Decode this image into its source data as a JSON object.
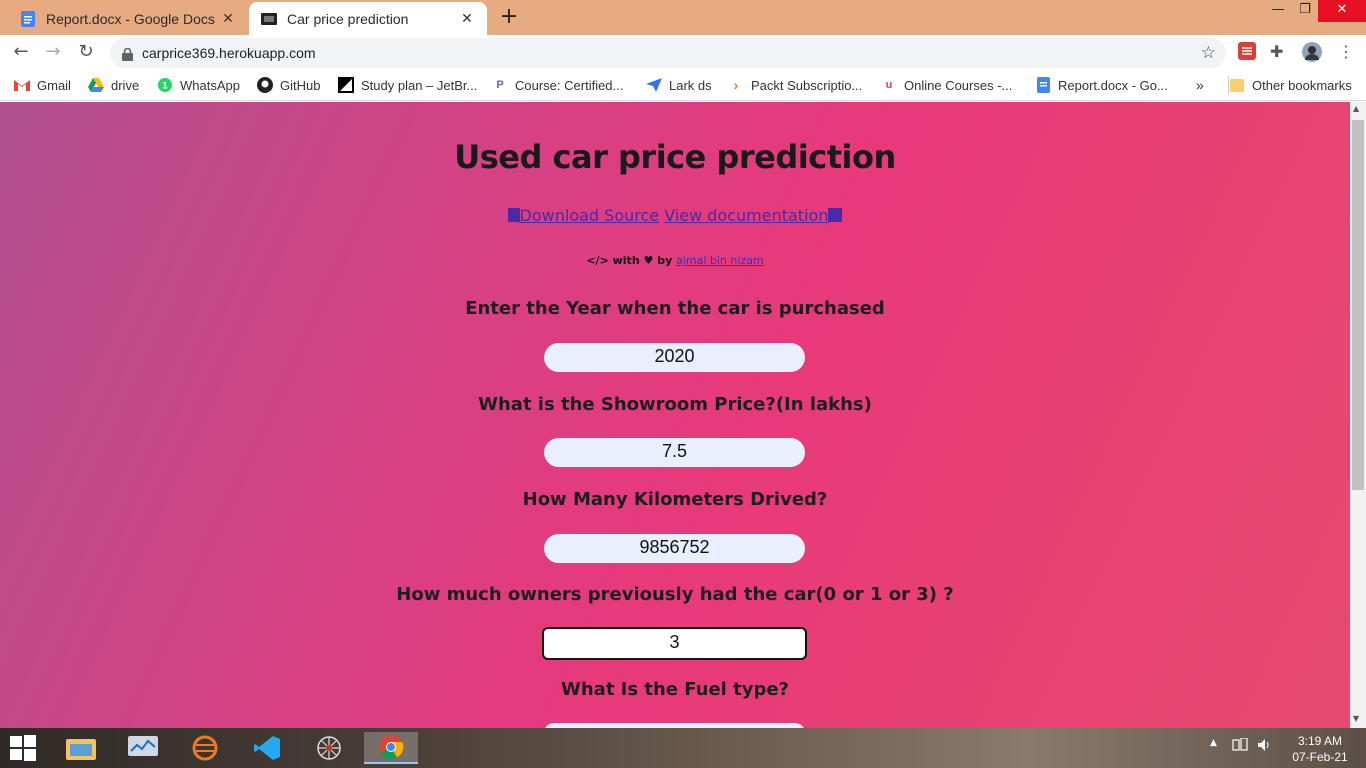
{
  "browser": {
    "tabs": [
      {
        "title": "Report.docx - Google Docs",
        "active": false
      },
      {
        "title": "Car price prediction",
        "active": true
      }
    ],
    "url": "carprice369.herokuapp.com",
    "bookmarks": [
      "Gmail",
      "drive",
      "WhatsApp",
      "GitHub",
      "Study plan – JetBr...",
      "Course: Certified...",
      "Lark ds",
      "Packt Subscriptio...",
      "Online Courses -...",
      "Report.docx - Go...",
      "Other bookmarks"
    ]
  },
  "page": {
    "title": "Used car price prediction",
    "download_link": "Download Source",
    "docs_link": "View documentation",
    "credit_prefix": "</> with ",
    "credit_by": " by ",
    "credit_author": "ajmal bin nizam",
    "form": {
      "year_label": "Enter the Year when the car is purchased",
      "year_value": "2020",
      "price_label": "What is the Showroom Price?(In lakhs)",
      "price_value": "7.5",
      "km_label": "How Many Kilometers Drived?",
      "km_value": "9856752",
      "owners_label": "How much owners previously had the car(0 or 1 or 3) ?",
      "owners_value": "3",
      "fuel_label": "What Is the Fuel type?"
    }
  },
  "taskbar": {
    "time": "3:19 AM",
    "date": "07-Feb-21"
  }
}
